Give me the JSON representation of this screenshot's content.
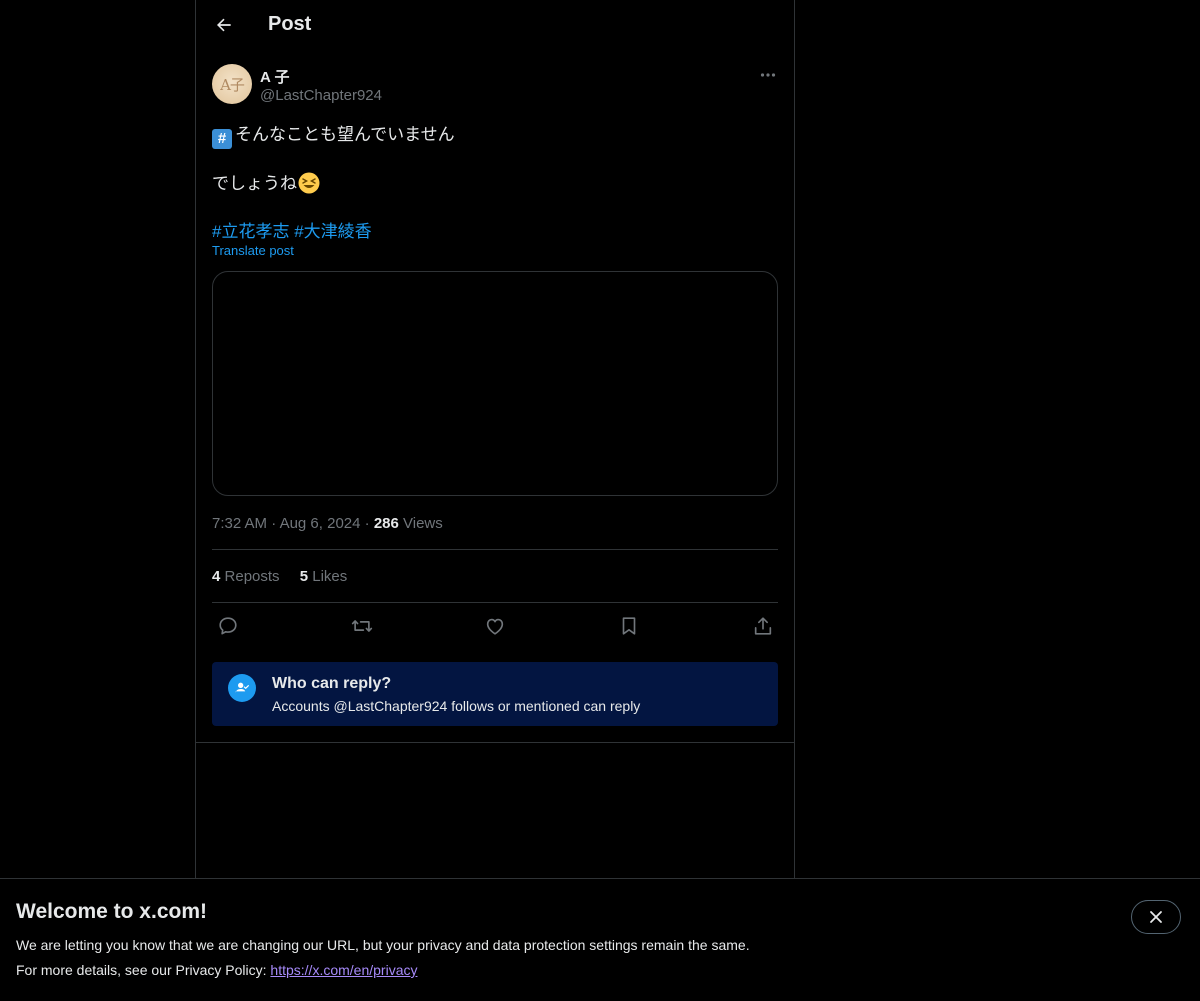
{
  "header": {
    "title": "Post",
    "back_icon": "arrow-left-icon"
  },
  "author": {
    "display_name": "A 子",
    "handle": "@LastChapter924",
    "avatar_text": "A子"
  },
  "tweet": {
    "line1_emoji": "#",
    "line1_text": "そんなことも望んでいません",
    "line2_text": "でしょうね",
    "hashtag1": "#立花孝志",
    "hashtag2": "#大津綾香",
    "translate_label": "Translate post"
  },
  "meta": {
    "time": "7:32 AM",
    "sep": "·",
    "date": "Aug 6, 2024",
    "views_count": "286",
    "views_label": "Views"
  },
  "stats": {
    "reposts_count": "4",
    "reposts_label": "Reposts",
    "likes_count": "5",
    "likes_label": "Likes"
  },
  "actions": [
    "reply-icon",
    "repost-icon",
    "like-icon",
    "bookmark-icon",
    "share-icon"
  ],
  "reply_restriction": {
    "title": "Who can reply?",
    "subtitle": "Accounts @LastChapter924 follows or mentioned can reply"
  },
  "banner": {
    "title": "Welcome to x.com!",
    "line1": "We are letting you know that we are changing our URL, but your privacy and data protection settings remain the same.",
    "line2_prefix": "For more details, see our Privacy Policy: ",
    "link": "https://x.com/en/privacy"
  },
  "colors": {
    "accent": "#1d9bf0",
    "background": "#000000",
    "border": "#2f3336",
    "muted": "#71767b",
    "reply_box": "#031541"
  }
}
